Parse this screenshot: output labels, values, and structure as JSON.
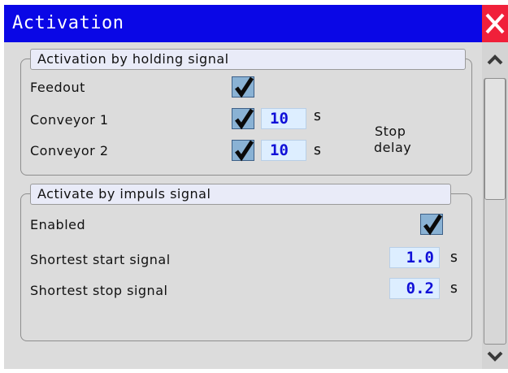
{
  "window": {
    "title": "Activation"
  },
  "holding": {
    "title": "Activation by holding signal",
    "feedout_label": "Feedout",
    "conveyor1_label": "Conveyor 1",
    "conveyor1_value": "10",
    "conveyor1_unit": "s",
    "conveyor2_label": "Conveyor 2",
    "conveyor2_value": "10",
    "conveyor2_unit": "s",
    "stop_delay_line1": "Stop",
    "stop_delay_line2": "delay",
    "feedout_checked": true,
    "conveyor1_checked": true,
    "conveyor2_checked": true
  },
  "impuls": {
    "title": "Activate by impuls signal",
    "enabled_label": "Enabled",
    "enabled_checked": true,
    "start_label": "Shortest start signal",
    "start_value": "1.0",
    "start_unit": "s",
    "stop_label": "Shortest stop signal",
    "stop_value": "0.2",
    "stop_unit": "s"
  },
  "colors": {
    "titlebar": "#0a07e6",
    "close": "#f0203a",
    "panel": "#dcdcdc",
    "field_text": "#1010d8"
  },
  "icons": {
    "close": "close-icon",
    "check": "checkmark-icon",
    "up": "chevron-up-icon",
    "down": "chevron-down-icon"
  }
}
